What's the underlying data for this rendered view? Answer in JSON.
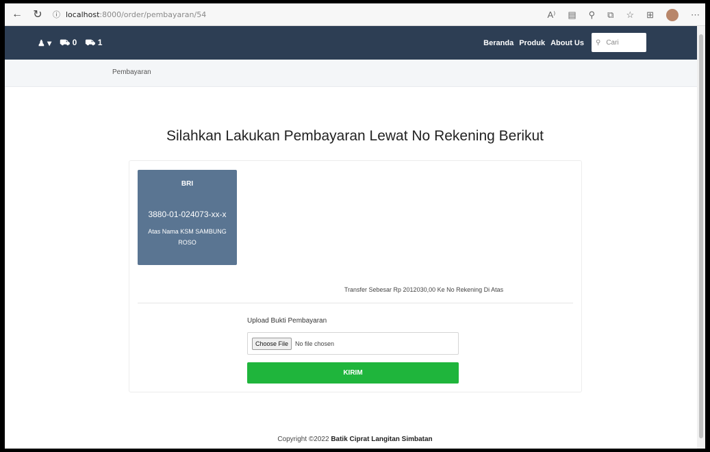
{
  "browser": {
    "back_icon": "arrow-left-icon",
    "reload_icon": "reload-icon",
    "info_icon": "info-icon",
    "url_host": "localhost",
    "url_path": ":8000/order/pembayaran/54",
    "toolbar_icons": [
      "read-aloud-icon",
      "reader-mode-icon",
      "zoom-icon",
      "extensions-icon",
      "favorites-icon",
      "collections-icon",
      "profile-icon",
      "more-icon"
    ]
  },
  "navbar": {
    "user_icon": "user-icon",
    "user_caret": "▾",
    "cart_icon": "cart-icon",
    "cart_count": "0",
    "cart2_count": "1",
    "links": [
      "Beranda",
      "Produk",
      "About Us"
    ],
    "search_placeholder": "Cari"
  },
  "breadcrumb": {
    "current": "Pembayaran"
  },
  "main": {
    "title": "Silahkan Lakukan Pembayaran Lewat No Rekening Berikut",
    "bank": {
      "name": "BRI",
      "account": "3880-01-024073-xx-x",
      "holder": "Atas Nama KSM SAMBUNG ROSO"
    },
    "transfer_text": "Transfer Sebesar Rp 2012030,00 Ke No Rekening Di Atas",
    "upload_label": "Upload Bukti Pembayaran",
    "file_button": "Choose File",
    "file_status": "No file chosen",
    "submit_label": "KIRIM"
  },
  "footer": {
    "prefix": "Copyright ©2022",
    "brand": "Batik Ciprat Langitan Simbatan"
  },
  "colors": {
    "navbar": "#2d3e54",
    "bank_box": "#5a7592",
    "submit": "#1fb53c"
  }
}
